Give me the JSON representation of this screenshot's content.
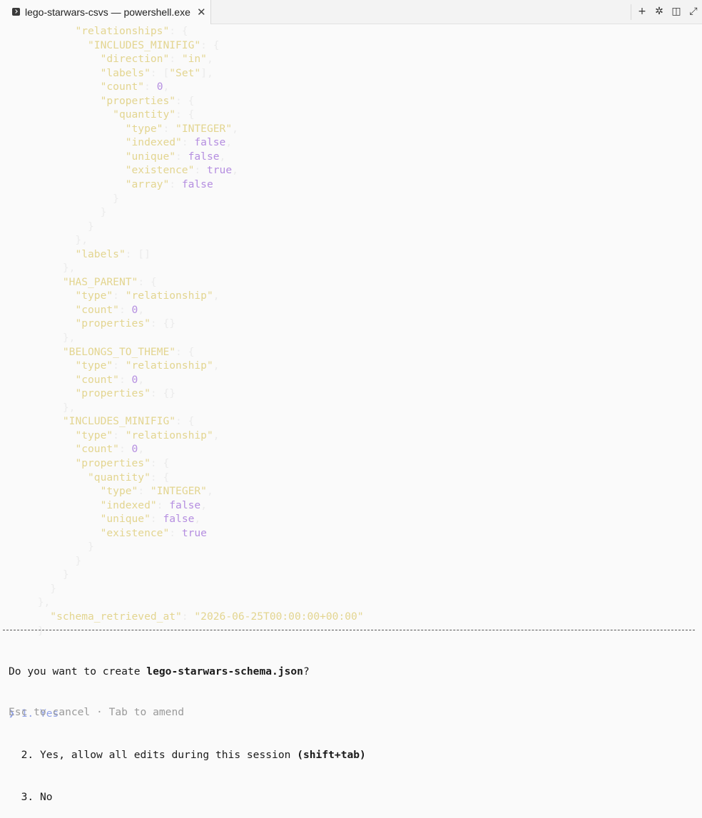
{
  "window": {
    "tab_title": "lego-starwars-csvs — powershell.exe",
    "close_glyph": "✕",
    "tab_icon": "terminal-icon",
    "toolbar": [
      {
        "name": "new-tab-icon",
        "glyph": "+"
      },
      {
        "name": "sparkle-icon",
        "glyph": "✲"
      },
      {
        "name": "split-pane-icon",
        "glyph": "◫"
      },
      {
        "name": "expand-icon",
        "glyph": "⤢"
      }
    ]
  },
  "terminal": {
    "lines": [
      [
        {
          "t": "            ",
          "c": "p"
        },
        {
          "t": "\"relationships\"",
          "c": "k"
        },
        {
          "t": ": {",
          "c": "p"
        }
      ],
      [
        {
          "t": "              ",
          "c": "p"
        },
        {
          "t": "\"INCLUDES_MINIFIG\"",
          "c": "k"
        },
        {
          "t": ": {",
          "c": "p"
        }
      ],
      [
        {
          "t": "                ",
          "c": "p"
        },
        {
          "t": "\"direction\"",
          "c": "k"
        },
        {
          "t": ": ",
          "c": "p"
        },
        {
          "t": "\"in\"",
          "c": "k"
        },
        {
          "t": ",",
          "c": "p"
        }
      ],
      [
        {
          "t": "                ",
          "c": "p"
        },
        {
          "t": "\"labels\"",
          "c": "k"
        },
        {
          "t": ": [",
          "c": "p"
        },
        {
          "t": "\"Set\"",
          "c": "k"
        },
        {
          "t": "],",
          "c": "p"
        }
      ],
      [
        {
          "t": "                ",
          "c": "p"
        },
        {
          "t": "\"count\"",
          "c": "k"
        },
        {
          "t": ": ",
          "c": "p"
        },
        {
          "t": "0",
          "c": "n"
        },
        {
          "t": ",",
          "c": "p"
        }
      ],
      [
        {
          "t": "                ",
          "c": "p"
        },
        {
          "t": "\"properties\"",
          "c": "k"
        },
        {
          "t": ": {",
          "c": "p"
        }
      ],
      [
        {
          "t": "                  ",
          "c": "p"
        },
        {
          "t": "\"quantity\"",
          "c": "k"
        },
        {
          "t": ": {",
          "c": "p"
        }
      ],
      [
        {
          "t": "                    ",
          "c": "p"
        },
        {
          "t": "\"type\"",
          "c": "k"
        },
        {
          "t": ": ",
          "c": "p"
        },
        {
          "t": "\"INTEGER\"",
          "c": "k"
        },
        {
          "t": ",",
          "c": "p"
        }
      ],
      [
        {
          "t": "                    ",
          "c": "p"
        },
        {
          "t": "\"indexed\"",
          "c": "k"
        },
        {
          "t": ": ",
          "c": "p"
        },
        {
          "t": "false",
          "c": "n"
        },
        {
          "t": ",",
          "c": "p"
        }
      ],
      [
        {
          "t": "                    ",
          "c": "p"
        },
        {
          "t": "\"unique\"",
          "c": "k"
        },
        {
          "t": ": ",
          "c": "p"
        },
        {
          "t": "false",
          "c": "n"
        },
        {
          "t": ",",
          "c": "p"
        }
      ],
      [
        {
          "t": "                    ",
          "c": "p"
        },
        {
          "t": "\"existence\"",
          "c": "k"
        },
        {
          "t": ": ",
          "c": "p"
        },
        {
          "t": "true",
          "c": "n"
        },
        {
          "t": ",",
          "c": "p"
        }
      ],
      [
        {
          "t": "                    ",
          "c": "p"
        },
        {
          "t": "\"array\"",
          "c": "k"
        },
        {
          "t": ": ",
          "c": "p"
        },
        {
          "t": "false",
          "c": "n"
        }
      ],
      [
        {
          "t": "                  }",
          "c": "p"
        }
      ],
      [
        {
          "t": "                }",
          "c": "p"
        }
      ],
      [
        {
          "t": "              }",
          "c": "p"
        }
      ],
      [
        {
          "t": "            },",
          "c": "p"
        }
      ],
      [
        {
          "t": "            ",
          "c": "p"
        },
        {
          "t": "\"labels\"",
          "c": "k"
        },
        {
          "t": ": []",
          "c": "p"
        }
      ],
      [
        {
          "t": "          },",
          "c": "p"
        }
      ],
      [
        {
          "t": "          ",
          "c": "p"
        },
        {
          "t": "\"HAS_PARENT\"",
          "c": "k"
        },
        {
          "t": ": {",
          "c": "p"
        }
      ],
      [
        {
          "t": "            ",
          "c": "p"
        },
        {
          "t": "\"type\"",
          "c": "k"
        },
        {
          "t": ": ",
          "c": "p"
        },
        {
          "t": "\"relationship\"",
          "c": "k"
        },
        {
          "t": ",",
          "c": "p"
        }
      ],
      [
        {
          "t": "            ",
          "c": "p"
        },
        {
          "t": "\"count\"",
          "c": "k"
        },
        {
          "t": ": ",
          "c": "p"
        },
        {
          "t": "0",
          "c": "n"
        },
        {
          "t": ",",
          "c": "p"
        }
      ],
      [
        {
          "t": "            ",
          "c": "p"
        },
        {
          "t": "\"properties\"",
          "c": "k"
        },
        {
          "t": ": {}",
          "c": "p"
        }
      ],
      [
        {
          "t": "          },",
          "c": "p"
        }
      ],
      [
        {
          "t": "          ",
          "c": "p"
        },
        {
          "t": "\"BELONGS_TO_THEME\"",
          "c": "k"
        },
        {
          "t": ": {",
          "c": "p"
        }
      ],
      [
        {
          "t": "            ",
          "c": "p"
        },
        {
          "t": "\"type\"",
          "c": "k"
        },
        {
          "t": ": ",
          "c": "p"
        },
        {
          "t": "\"relationship\"",
          "c": "k"
        },
        {
          "t": ",",
          "c": "p"
        }
      ],
      [
        {
          "t": "            ",
          "c": "p"
        },
        {
          "t": "\"count\"",
          "c": "k"
        },
        {
          "t": ": ",
          "c": "p"
        },
        {
          "t": "0",
          "c": "n"
        },
        {
          "t": ",",
          "c": "p"
        }
      ],
      [
        {
          "t": "            ",
          "c": "p"
        },
        {
          "t": "\"properties\"",
          "c": "k"
        },
        {
          "t": ": {}",
          "c": "p"
        }
      ],
      [
        {
          "t": "          },",
          "c": "p"
        }
      ],
      [
        {
          "t": "          ",
          "c": "p"
        },
        {
          "t": "\"INCLUDES_MINIFIG\"",
          "c": "k"
        },
        {
          "t": ": {",
          "c": "p"
        }
      ],
      [
        {
          "t": "            ",
          "c": "p"
        },
        {
          "t": "\"type\"",
          "c": "k"
        },
        {
          "t": ": ",
          "c": "p"
        },
        {
          "t": "\"relationship\"",
          "c": "k"
        },
        {
          "t": ",",
          "c": "p"
        }
      ],
      [
        {
          "t": "            ",
          "c": "p"
        },
        {
          "t": "\"count\"",
          "c": "k"
        },
        {
          "t": ": ",
          "c": "p"
        },
        {
          "t": "0",
          "c": "n"
        },
        {
          "t": ",",
          "c": "p"
        }
      ],
      [
        {
          "t": "            ",
          "c": "p"
        },
        {
          "t": "\"properties\"",
          "c": "k"
        },
        {
          "t": ": {",
          "c": "p"
        }
      ],
      [
        {
          "t": "              ",
          "c": "p"
        },
        {
          "t": "\"quantity\"",
          "c": "k"
        },
        {
          "t": ": {",
          "c": "p"
        }
      ],
      [
        {
          "t": "                ",
          "c": "p"
        },
        {
          "t": "\"type\"",
          "c": "k"
        },
        {
          "t": ": ",
          "c": "p"
        },
        {
          "t": "\"INTEGER\"",
          "c": "k"
        },
        {
          "t": ",",
          "c": "p"
        }
      ],
      [
        {
          "t": "                ",
          "c": "p"
        },
        {
          "t": "\"indexed\"",
          "c": "k"
        },
        {
          "t": ": ",
          "c": "p"
        },
        {
          "t": "false",
          "c": "n"
        },
        {
          "t": ",",
          "c": "p"
        }
      ],
      [
        {
          "t": "                ",
          "c": "p"
        },
        {
          "t": "\"unique\"",
          "c": "k"
        },
        {
          "t": ": ",
          "c": "p"
        },
        {
          "t": "false",
          "c": "n"
        },
        {
          "t": ",",
          "c": "p"
        }
      ],
      [
        {
          "t": "                ",
          "c": "p"
        },
        {
          "t": "\"existence\"",
          "c": "k"
        },
        {
          "t": ": ",
          "c": "p"
        },
        {
          "t": "true",
          "c": "n"
        }
      ],
      [
        {
          "t": "              }",
          "c": "p"
        }
      ],
      [
        {
          "t": "            }",
          "c": "p"
        }
      ],
      [
        {
          "t": "          }",
          "c": "p"
        }
      ],
      [
        {
          "t": "        }",
          "c": "p"
        }
      ],
      [
        {
          "t": "      },",
          "c": "p"
        }
      ],
      [
        {
          "t": "        ",
          "c": "p"
        },
        {
          "t": "\"schema_retrieved_at\"",
          "c": "k"
        },
        {
          "t": ": ",
          "c": "p"
        },
        {
          "t": "\"2026-06-25T00:00:00+00:00\"",
          "c": "k"
        }
      ],
      [
        {
          "t": "      }",
          "c": "p"
        }
      ]
    ]
  },
  "dialog": {
    "question_prefix": "Do you want to create ",
    "question_file": "lego-starwars-schema.json",
    "question_suffix": "?",
    "cursor_glyph": "❯",
    "options": [
      {
        "number": "1.",
        "label": "Yes",
        "bold": ""
      },
      {
        "number": "2.",
        "label": "Yes, allow all edits during this session ",
        "bold": "(shift+tab)"
      },
      {
        "number": "3.",
        "label": "No",
        "bold": ""
      }
    ],
    "selected_index": 0,
    "hint": "Esc to cancel · Tab to amend"
  }
}
